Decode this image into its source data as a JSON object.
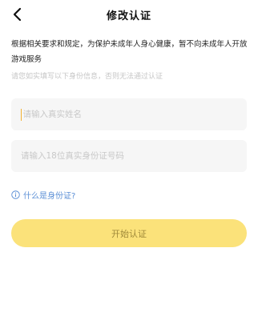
{
  "header": {
    "title": "修改认证",
    "back_icon": "chevron-left-icon"
  },
  "notice": {
    "text": "根据相关要求和规定，为保护未成年人身心健康，暂不向未成年人开放游戏服务"
  },
  "hint": {
    "text": "请您如实填写以下身份信息，否则无法通过认证"
  },
  "form": {
    "name_placeholder": "请输入真实姓名",
    "id_placeholder": "请输入18位真实身份证号码"
  },
  "help": {
    "icon": "info-circle-icon",
    "label": "什么是身份证?"
  },
  "actions": {
    "start_label": "开始认证"
  },
  "colors": {
    "accent_yellow": "#fbe27a",
    "button_text": "#a08a3a",
    "link_blue": "#5b8fd6",
    "caret": "#f3b02f",
    "field_bg": "#f6f6f6"
  }
}
